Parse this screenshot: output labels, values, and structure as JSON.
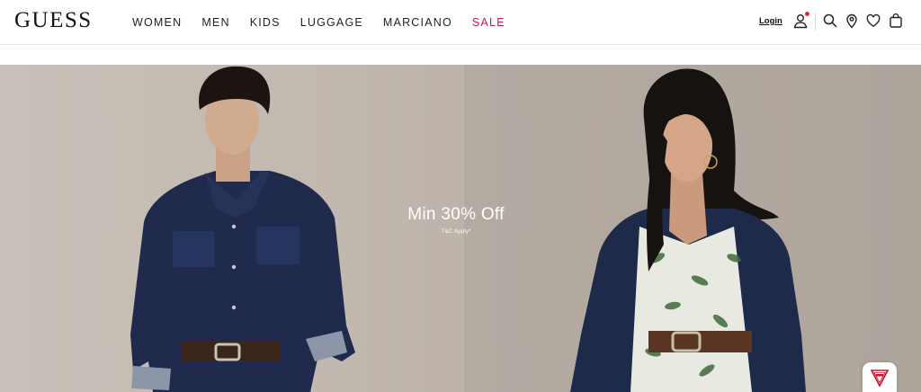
{
  "brand": {
    "logo_text": "GUESS"
  },
  "nav": {
    "items": [
      {
        "label": "WOMEN"
      },
      {
        "label": "MEN"
      },
      {
        "label": "KIDS"
      },
      {
        "label": "LUGGAGE"
      },
      {
        "label": "MARCIANO"
      },
      {
        "label": "SALE"
      }
    ]
  },
  "header_actions": {
    "login_label": "Login",
    "icons": [
      "account-icon",
      "search-icon",
      "store-locator-icon",
      "wishlist-icon",
      "bag-icon"
    ]
  },
  "hero": {
    "promo_title": "Min 30% Off",
    "promo_subtitle": "T&C Apply*"
  },
  "colors": {
    "sale_accent": "#c2185b",
    "notification_dot": "#e0282e",
    "denim": "#1f2a4d"
  }
}
